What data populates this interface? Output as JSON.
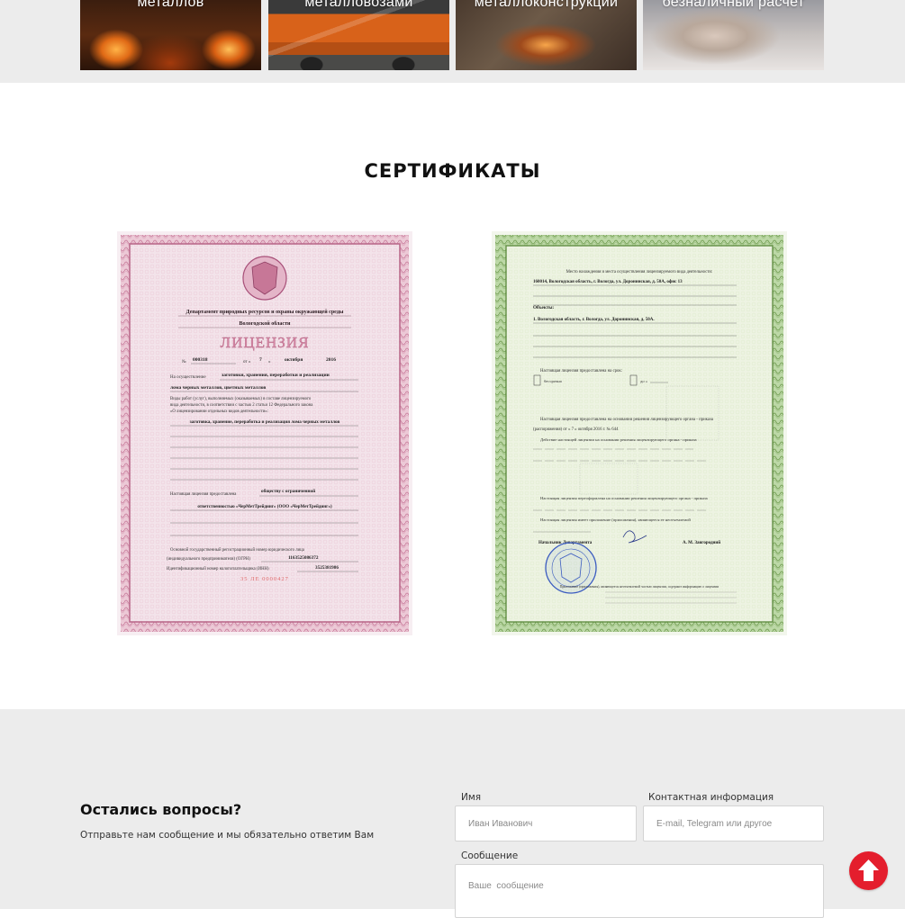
{
  "services": [
    {
      "caption": "металлов",
      "icon": "molten-metal-photo"
    },
    {
      "caption": "металловозами",
      "icon": "truck-photo"
    },
    {
      "caption": "металлоконструкции",
      "icon": "metal-cutting-photo"
    },
    {
      "caption": "безналичный расчет",
      "icon": "handshake-photo"
    }
  ],
  "certificates": {
    "title": "СЕРТИФИКАТЫ",
    "items": [
      {
        "header": "Департамент природных ресурсов и охраны окружающей среды",
        "region": "Вологодской области",
        "heading": "ЛИЦЕНЗИЯ",
        "number": "000318",
        "day": "7",
        "month": "октября",
        "year": "2016",
        "activity_intro": "На осуществление",
        "activity": "заготовки, хранения, переработки и реализации",
        "activity_2": "лома черных металлов, цветных металлов",
        "works_title": "Виды работ (услуг), выполняемых (оказываемых) в составе лицензируемого",
        "works_title_2": "вида деятельности, в соответствии с частью 2 статьи 12 Федерального закона",
        "works_title_3": "«О лицензировании отдельных видов деятельности»:",
        "works": "заготовка, хранение, переработка и реализация лома черных металлов",
        "granted_to_label": "Настоящая лицензия предоставлена",
        "granted_to": "обществу с ограниченной",
        "granted_to_2": "ответственностью «ЧерМетТрейдинг» (ООО «ЧерМетТрейдинг»)",
        "ogrn_label": "Основной государственный регистрационный номер юридического лица",
        "ogrn_label_2": "(индивидуального предпринимателя) (ОГРН)",
        "ogrn": "1163525086372",
        "inn_label": "Идентификационный номер налогоплательщика (ИНН)",
        "inn": "3525381986",
        "serial": "35 ЛЕ 0000427"
      },
      {
        "place_label": "Место нахождения и места осуществления лицензируемого вида деятельности:",
        "address": "160014, Вологодская область, г. Вологда, ул. Доронинская, д. 50А, офис 13",
        "objects_label": "Объекты:",
        "object": "1. Вологодская область, г. Вологда, ул. Доронинская, д. 50А.",
        "term_label": "Настоящая лицензия предоставлена на срок:",
        "term": "бессрочно",
        "term_until": "до «",
        "basis": "Настоящая лицензия предоставлена на основании решения лицензирующего органа - приказа",
        "basis_2": "(распоряжения) от « 7 » октября 2016 г. № 644",
        "extended": "Действие настоящей лицензии на основании решения лицензирующего органа - приказа",
        "reissued": "Настоящая лицензия переоформлена на основании решения лицензирующего органа - приказа",
        "appendix": "Настоящая лицензия имеет приложение (приложения), являющееся ее неотъемлемой",
        "chief_title": "Начальник Департамента",
        "chief_name": "А. М. Завгородний",
        "footer": "Приложение (приложения), являющееся неотъемлемой частью лицензии, содержит информацию о лицензии"
      }
    ]
  },
  "contact": {
    "title": "Остались вопросы?",
    "subtitle": "Отправьте нам сообщение и мы обязательно ответим Вам",
    "name_label": "Имя",
    "name_placeholder": "Иван Иванович",
    "contact_label": "Контактная информация",
    "contact_placeholder": "E-mail, Telegram или другое",
    "message_label": "Сообщение",
    "message_placeholder": "Ваше  сообщение"
  },
  "scroll_top": {
    "icon": "arrow-up-icon",
    "color": "#e41e2d"
  }
}
